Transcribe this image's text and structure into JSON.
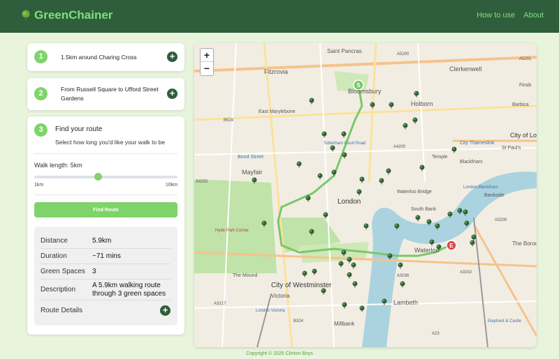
{
  "brand": {
    "name": "GreenChainer",
    "logo_icon": "tree-icon"
  },
  "nav": {
    "how_to_use": "How to use",
    "about": "About"
  },
  "cards": [
    {
      "number": "1",
      "text": "1.5km around Charing Cross"
    },
    {
      "number": "2",
      "text": "From Russell Square to Ufford Street Gardens"
    }
  ],
  "find": {
    "number": "3",
    "title": "Find your route",
    "subtitle": "Select how long you'd like your walk to be",
    "walk_length_label": "Walk length: 5km",
    "slider_min": "1km",
    "slider_max": "10km",
    "slider_value_km": 5,
    "button": "Find Route"
  },
  "results": {
    "distance_label": "Distance",
    "distance_value": "5.9km",
    "duration_label": "Duration",
    "duration_value": "~71 mins",
    "green_label": "Green Spaces",
    "green_value": "3",
    "description_label": "Description",
    "description_value": "A 5.9km walking route through 3 green spaces",
    "details_label": "Route Details"
  },
  "map": {
    "zoom_in": "+",
    "zoom_out": "−",
    "labels": {
      "saint_pancras": "Saint Pancras",
      "fitzrovia": "Fitzrovia",
      "bloomsbury": "Bloomsbury",
      "holborn": "Holborn",
      "clerkenwell": "Clerkenwell",
      "east_marylebone": "East Marylebone",
      "tottenham_court_road": "Tottenham Court Road",
      "bond_street": "Bond Street",
      "mayfair": "Mayfair",
      "london": "London",
      "waterloo_bridge": "Waterloo Bridge",
      "south_bank": "South Bank",
      "city_thameslink": "City Thameslink",
      "temple": "Temple",
      "blackfriars": "Blackfriars",
      "london_blackfriars": "London Blackfriars",
      "bankside": "Bankside",
      "city_of_westminster": "City of Westminster",
      "victoria": "Victoria",
      "london_victoria": "London Victoria",
      "lambeth": "Lambeth",
      "millbank": "Millbank",
      "waterloo": "Waterloo",
      "hyde_park_corner": "Hyde Park Corner",
      "the_mound": "The Mound",
      "elephant_castle": "Elephant & Castle",
      "the_borough": "The Borough",
      "city_of_london": "City of Lo",
      "barbican": "Barbica",
      "finsbury": "Finsb",
      "st_pauls": "St Paul's",
      "a5200": "A5200",
      "a5201": "A5201",
      "b524": "B524",
      "a4202": "A4202",
      "a3036": "A3036",
      "a3217": "A3217",
      "b324": "B324",
      "a23": "A23",
      "a3202": "A3202",
      "a3200": "A3200",
      "a4200": "A4200",
      "start_marker": "S",
      "end_marker": "E"
    },
    "route_color": "#78c96a",
    "marker_color": "#2e5e3c"
  },
  "footer": "Copyright © 2025 Clinton Boys"
}
